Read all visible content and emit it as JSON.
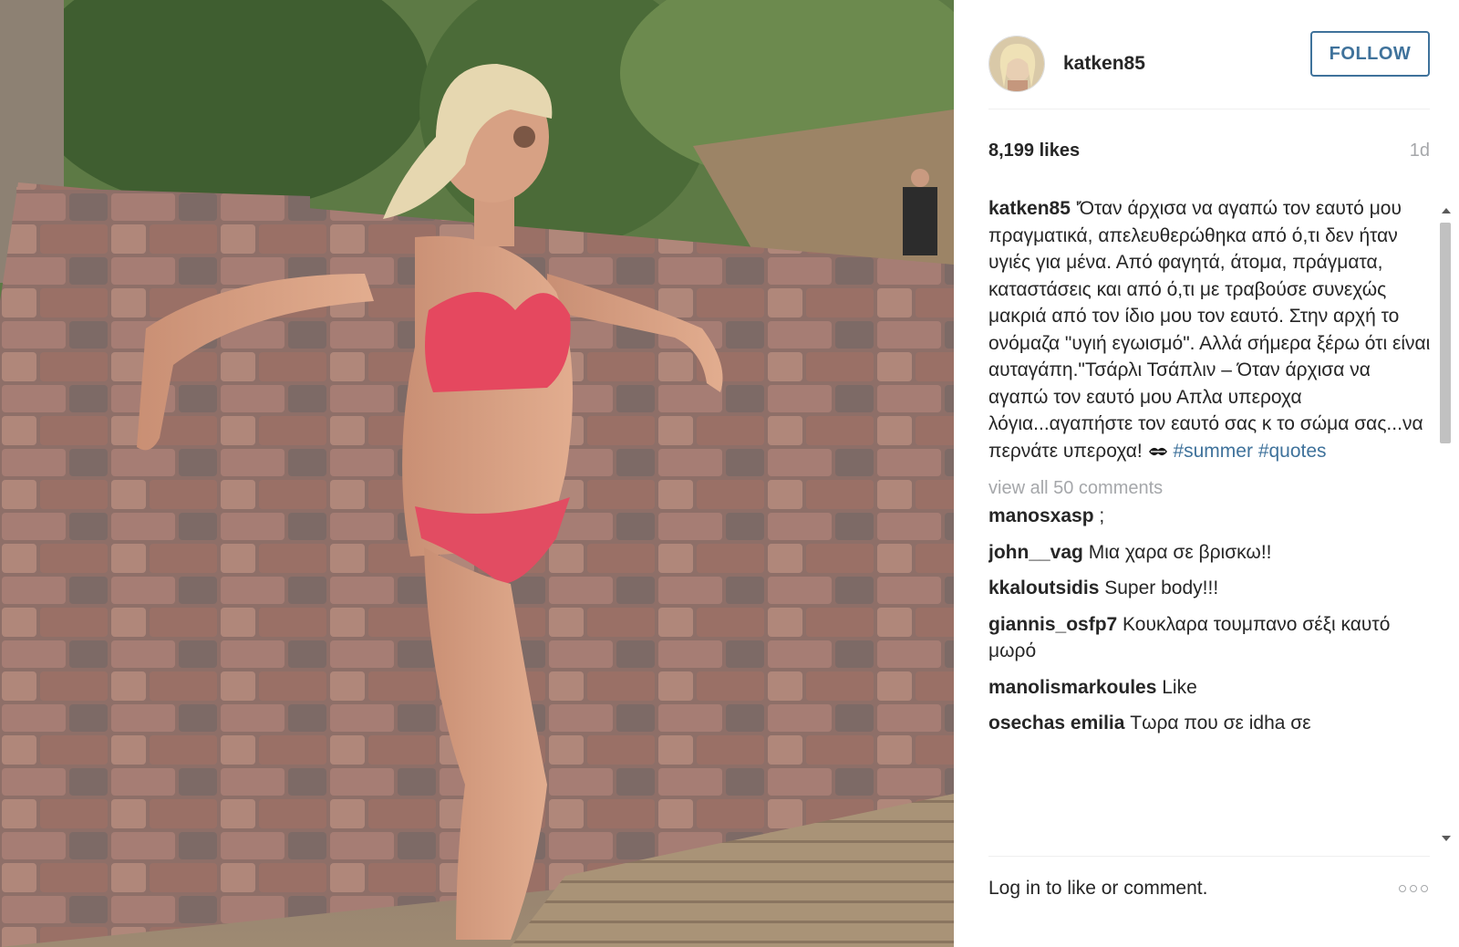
{
  "header": {
    "username": "katken85",
    "follow_label": "FOLLOW"
  },
  "stats": {
    "likes": "8,199 likes",
    "age": "1d"
  },
  "caption": {
    "username": "katken85",
    "text": "'Όταν άρχισα να αγαπώ τον εαυτό μου πραγματικά, απελευθερώθηκα από ό,τι δεν ήταν υγιές για μένα. Από φαγητά, άτομα, πράγματα, καταστάσεις και από ό,τι με τραβούσε συνεχώς μακριά από τον ίδιο μου τον εαυτό. Στην αρχή το ονόμαζα \"υγιή εγωισμό\". Αλλά σήμερα ξέρω ότι είναι αυταγάπη.\"Τσάρλι Τσάπλιν – Όταν άρχισα να αγαπώ τον εαυτό μου Απλα υπεροχα λόγια...αγαπήστε τον εαυτό σας κ το σώμα σας...να περνάτε υπεροχα!",
    "hashtags": [
      "#summer",
      "#quotes"
    ]
  },
  "view_all_label": "view all 50 comments",
  "comments": [
    {
      "user": "manosxasp",
      "text": ";"
    },
    {
      "user": "john__vag",
      "text": "Μια χαρα σε βρισκω!!"
    },
    {
      "user": "kkaloutsidis",
      "text": "Super body!!!"
    },
    {
      "user": "giannis_osfp7",
      "text": "Κουκλαρα τουμπανο σέξι καυτό μωρό"
    },
    {
      "user": "manolismarkoules",
      "text": "Like"
    },
    {
      "user": "osechas emilia",
      "text": "Τωρα που σε idha σε"
    }
  ],
  "footer": {
    "login_prompt": "Log in to like or comment."
  },
  "icons": {
    "more": "more-options-icon",
    "kiss": "kiss-emoji-icon"
  },
  "colors": {
    "link_blue": "#3f729b",
    "muted_gray": "#a5a7aa",
    "text": "#262626"
  }
}
